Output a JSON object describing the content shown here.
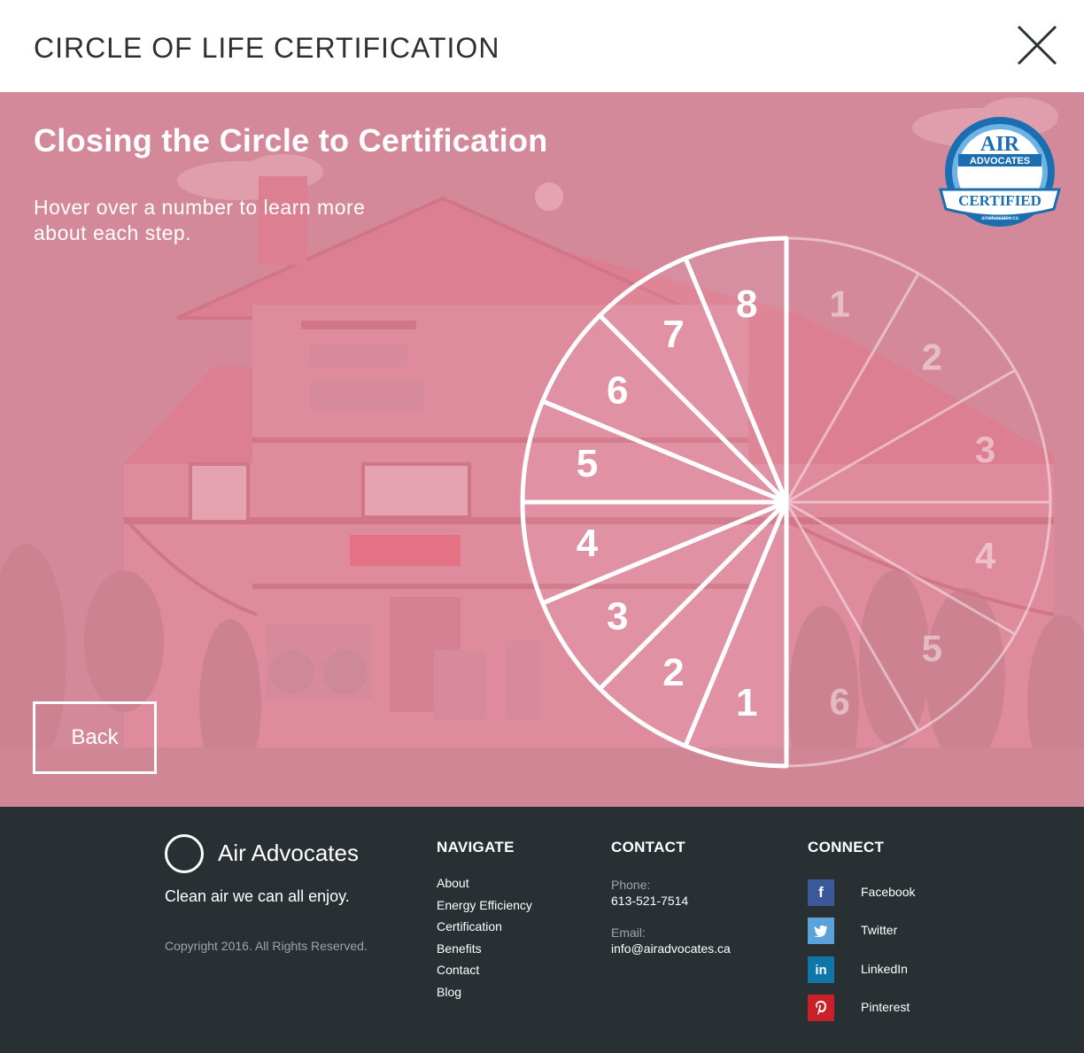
{
  "header": {
    "title": "CIRCLE OF LIFE CERTIFICATION",
    "close_icon": "close-icon"
  },
  "hero": {
    "title": "Closing the Circle to Certification",
    "instructions": "Hover over a number to learn more about each step.",
    "back_label": "Back",
    "badge": {
      "line1": "AIR",
      "line2": "ADVOCATES",
      "ribbon": "CERTIFIED",
      "url": "airadvocates.ca"
    },
    "active_segments": [
      "1",
      "2",
      "3",
      "4",
      "5",
      "6",
      "7",
      "8"
    ],
    "inactive_segments": [
      "1",
      "2",
      "3",
      "4",
      "5",
      "6"
    ]
  },
  "footer": {
    "brand_name": "Air Advocates",
    "tagline": "Clean air we can all enjoy.",
    "copyright": "Copyright 2016. All Rights Reserved.",
    "navigate": {
      "heading": "NAVIGATE",
      "items": [
        "About",
        "Energy Efficiency",
        "Certification",
        "Benefits",
        "Contact",
        "Blog"
      ]
    },
    "contact": {
      "heading": "CONTACT",
      "phone_label": "Phone:",
      "phone": "613-521-7514",
      "email_label": "Email:",
      "email": "info@airadvocates.ca"
    },
    "connect": {
      "heading": "CONNECT",
      "items": [
        {
          "label": "Facebook",
          "icon": "facebook-icon",
          "color": "#3b5998",
          "glyph": "f"
        },
        {
          "label": "Twitter",
          "icon": "twitter-icon",
          "color": "#5aa2d9",
          "glyph": "t"
        },
        {
          "label": "LinkedIn",
          "icon": "linkedin-icon",
          "color": "#0e76a8",
          "glyph": "in"
        },
        {
          "label": "Pinterest",
          "icon": "pinterest-icon",
          "color": "#cb2027",
          "glyph": "p"
        }
      ]
    }
  },
  "colors": {
    "hero_bg": "#d5899b",
    "footer_bg": "#283034",
    "accent_white": "#ffffff"
  }
}
